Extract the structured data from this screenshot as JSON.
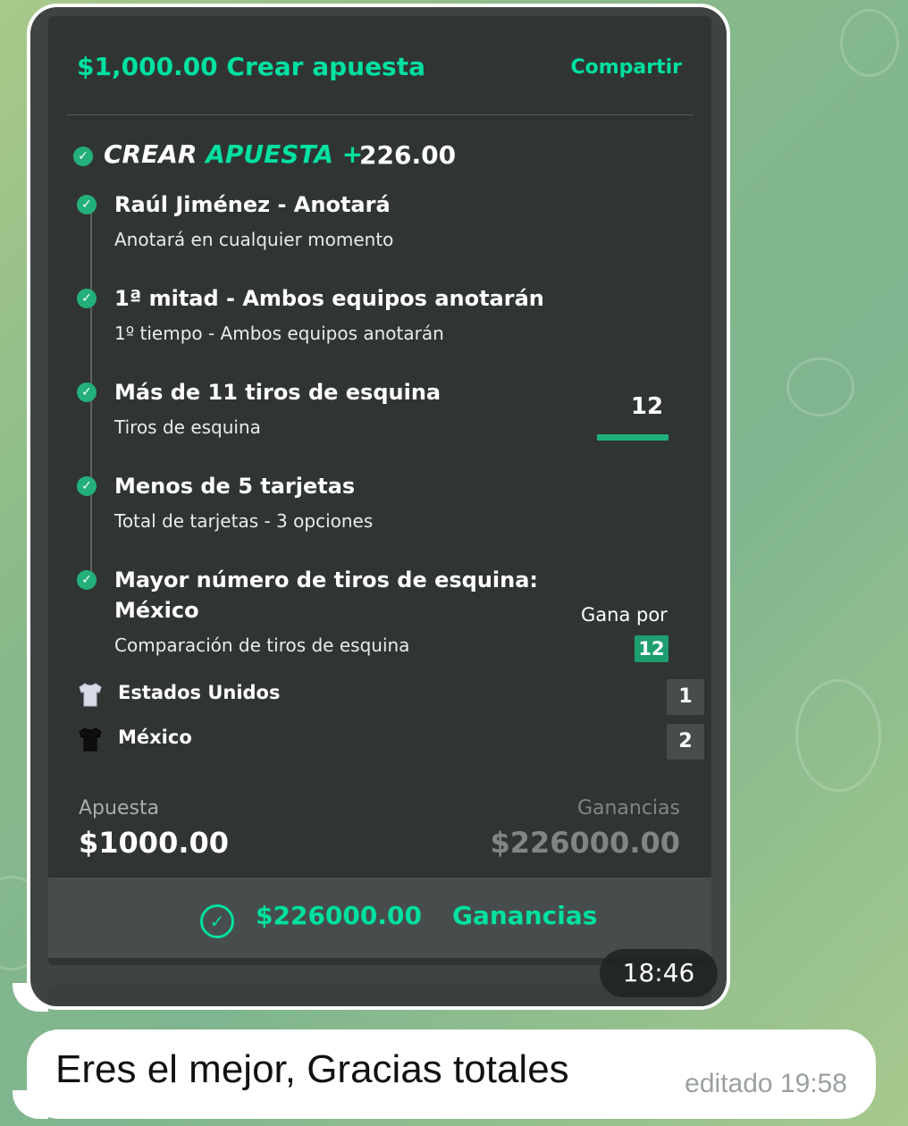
{
  "header": {
    "title": "$1,000.00 Crear apuesta",
    "share_label": "Compartir"
  },
  "betbuilder": {
    "label_prefix": "CREAR",
    "label_accent": "APUESTA +",
    "odds": "226.00"
  },
  "selections": [
    {
      "title": "Raúl Jiménez - Anotará",
      "subtitle": "Anotará en cualquier momento"
    },
    {
      "title": "1ª mitad - Ambos equipos anotarán",
      "subtitle": "1º tiempo - Ambos equipos anotarán"
    },
    {
      "title": "Más de 11 tiros de esquina",
      "subtitle": "Tiros de esquina"
    },
    {
      "title": "Menos de 5 tarjetas",
      "subtitle": "Total de tarjetas - 3 opciones"
    },
    {
      "title": "Mayor número de tiros de esquina:",
      "title_line2": "México",
      "subtitle": "Comparación de tiros de esquina"
    }
  ],
  "corner_stat": {
    "value": "12"
  },
  "comparison": {
    "gana_label": "Gana por",
    "gana_value": "12",
    "teams": [
      {
        "name": "Estados Unidos",
        "score": "1",
        "jersey_color": "#d8dbe8"
      },
      {
        "name": "México",
        "score": "2",
        "jersey_color": "#0e0e0e"
      }
    ]
  },
  "totals": {
    "stake_label": "Apuesta",
    "stake_value": "$1000.00",
    "winnings_label": "Ganancias",
    "winnings_value": "$226000.00"
  },
  "payout": {
    "amount": "$226000.00",
    "label": "Ganancias"
  },
  "message_time": "18:46",
  "reply": {
    "text": "Eres el mejor, Gracias totales",
    "meta": "editado 19:58"
  },
  "colors": {
    "accent": "#00e0a0",
    "card_bg": "#303534",
    "check_green": "#23b07a"
  }
}
